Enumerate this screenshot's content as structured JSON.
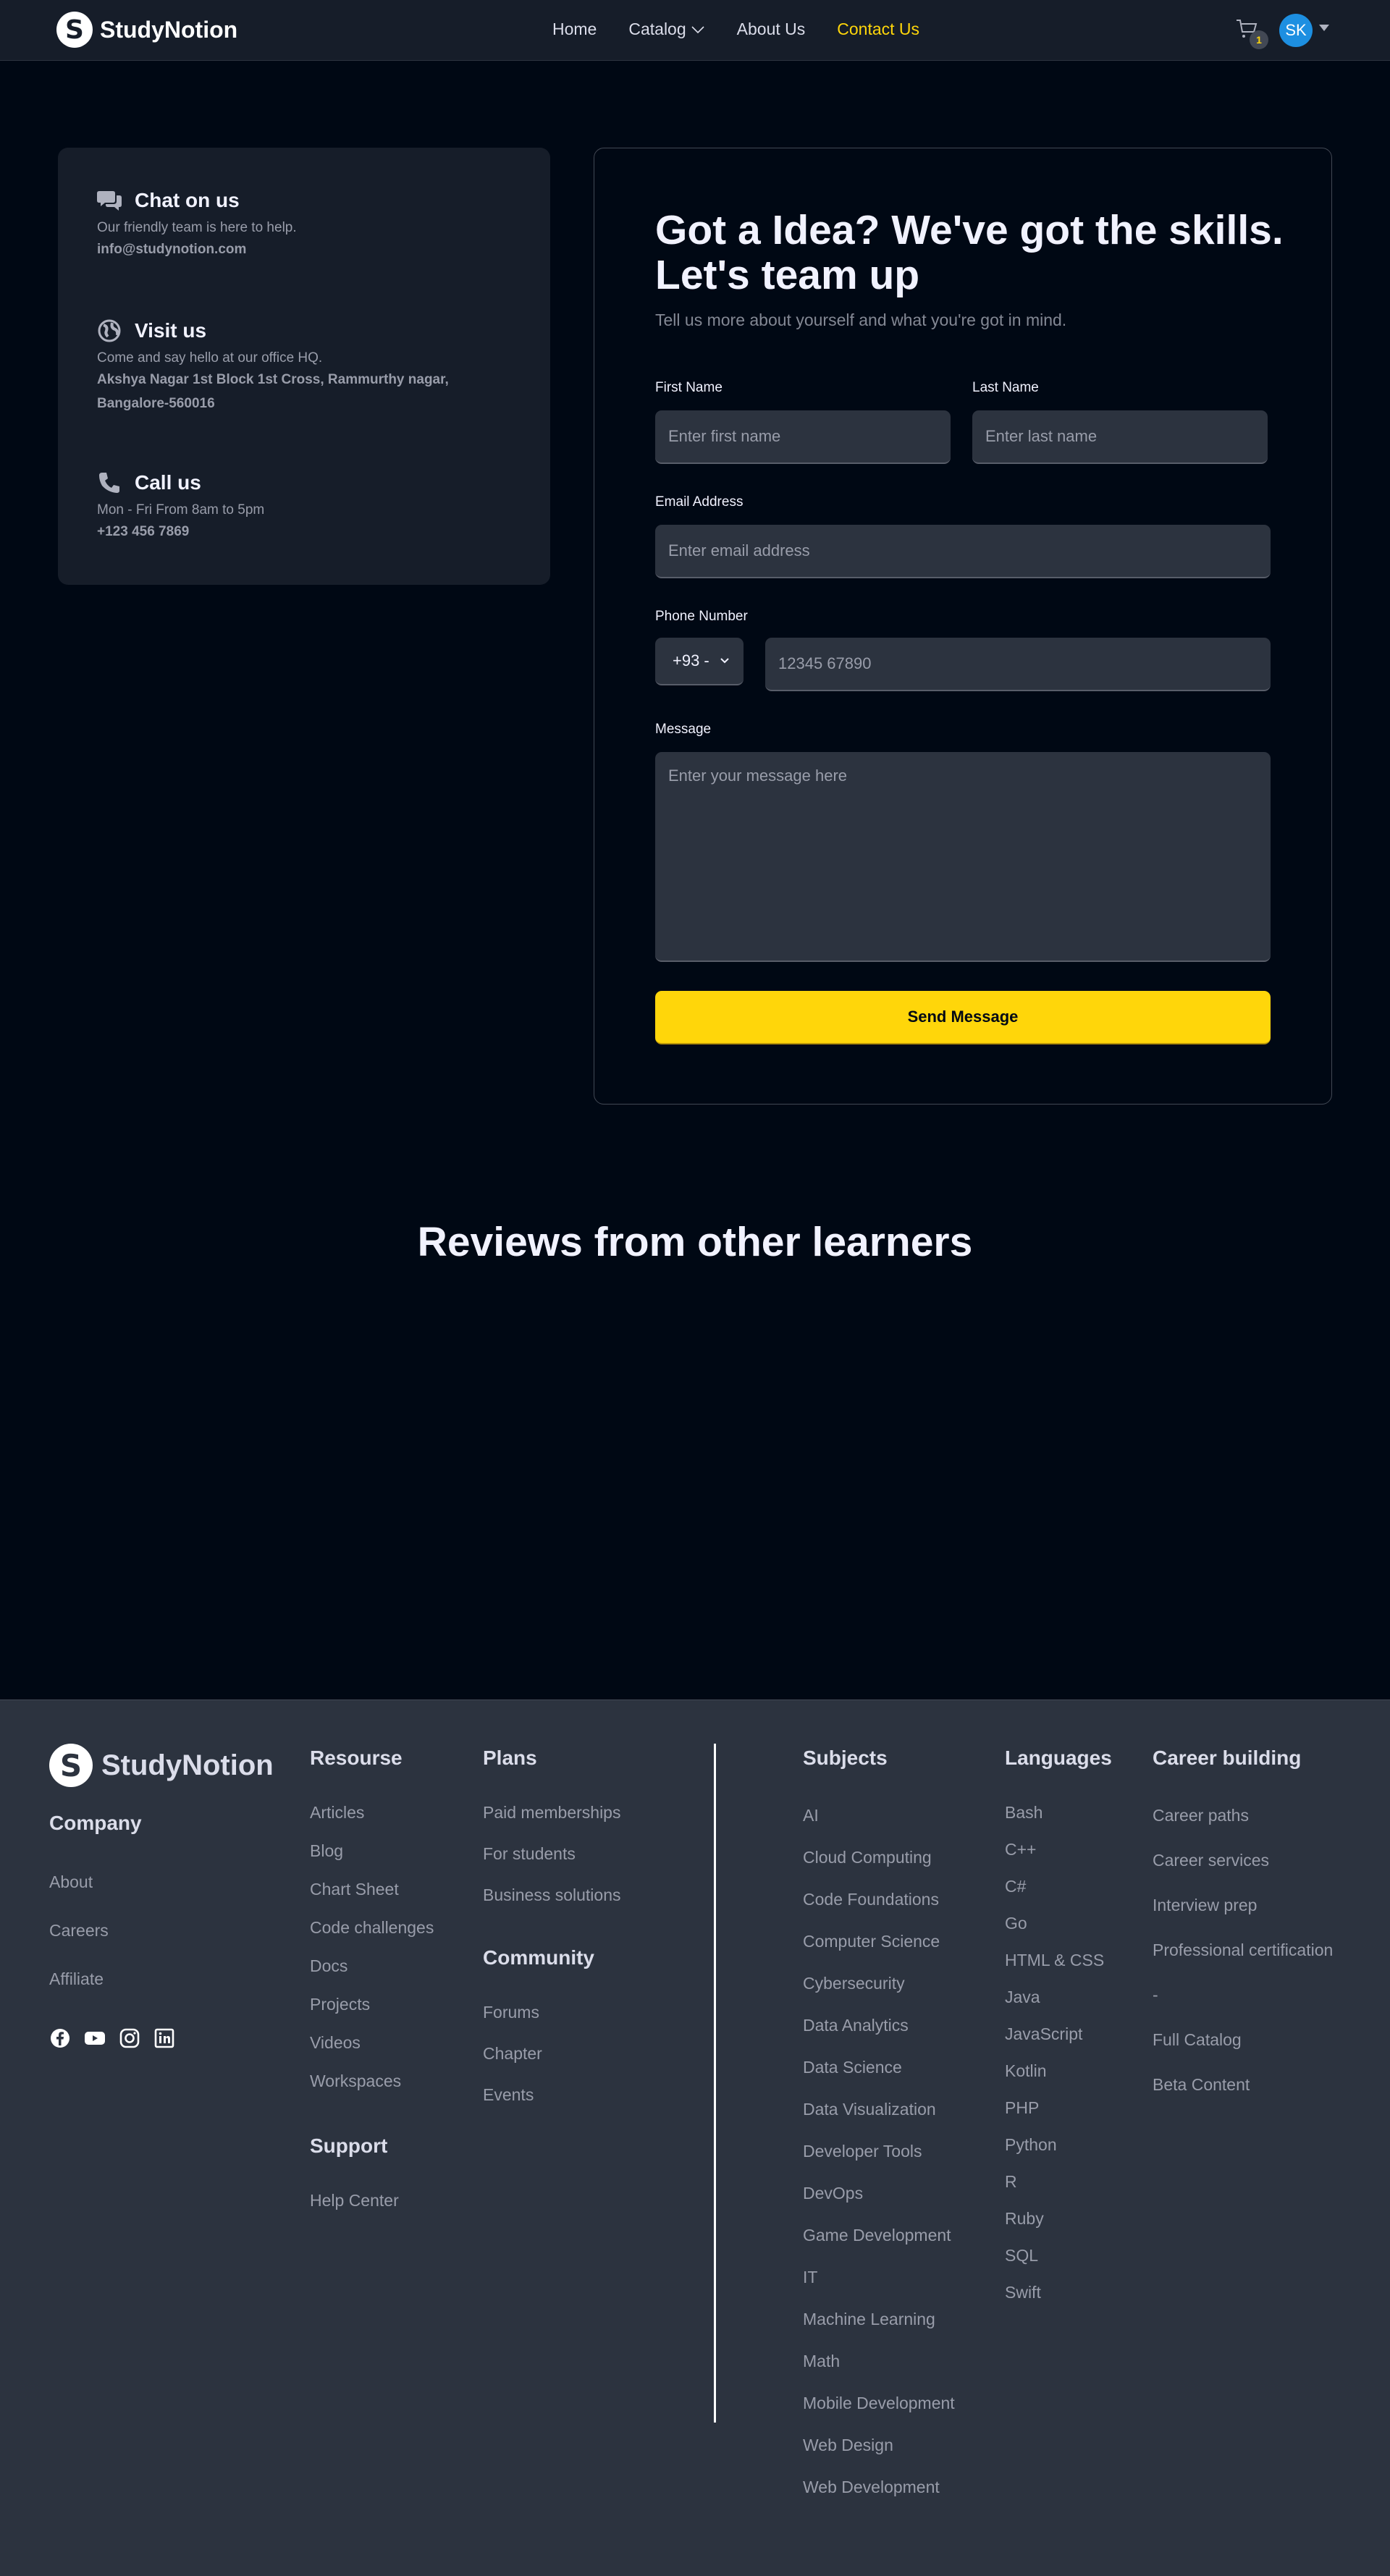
{
  "navbar": {
    "brand": "StudyNotion",
    "logo_letter": "S",
    "links": [
      {
        "label": "Home"
      },
      {
        "label": "Catalog"
      },
      {
        "label": "About Us"
      },
      {
        "label": "Contact Us",
        "active": true
      }
    ],
    "cart_count": "1",
    "avatar_initials": "SK"
  },
  "contact_details": [
    {
      "icon": "chat-icon",
      "title": "Chat on us",
      "text": "Our friendly team is here to help.",
      "strong": "info@studynotion.com"
    },
    {
      "icon": "globe-icon",
      "title": "Visit us",
      "text": "Come and say hello at our office HQ.",
      "strong": "Akshya Nagar 1st Block 1st Cross, Rammurthy nagar, Bangalore-560016"
    },
    {
      "icon": "phone-icon",
      "title": "Call us",
      "text": "Mon - Fri From 8am to 5pm",
      "strong": "+123 456 7869"
    }
  ],
  "form": {
    "title": "Got a Idea? We've got the skills. Let's team up",
    "subtitle": "Tell us more about yourself and what you're got in mind.",
    "first_name": {
      "label": "First Name",
      "placeholder": "Enter first name"
    },
    "last_name": {
      "label": "Last Name",
      "placeholder": "Enter last name"
    },
    "email": {
      "label": "Email Address",
      "placeholder": "Enter email address"
    },
    "phone": {
      "label": "Phone Number",
      "code": "+93 -",
      "placeholder": "12345 67890"
    },
    "message": {
      "label": "Message",
      "placeholder": "Enter your message here"
    },
    "submit": "Send Message"
  },
  "reviews": {
    "title": "Reviews from other learners"
  },
  "footer": {
    "brand": "StudyNotion",
    "logo_letter": "S",
    "company": {
      "title": "Company",
      "items": [
        "About",
        "Careers",
        "Affiliate"
      ]
    },
    "social_icons": [
      "facebook-icon",
      "youtube-icon",
      "instagram-icon",
      "linkedin-icon"
    ],
    "resources": {
      "title": "Resourse",
      "items": [
        "Articles",
        "Blog",
        "Chart Sheet",
        "Code challenges",
        "Docs",
        "Projects",
        "Videos",
        "Workspaces"
      ]
    },
    "support": {
      "title": "Support",
      "items": [
        "Help Center"
      ]
    },
    "plans": {
      "title": "Plans",
      "items": [
        "Paid memberships",
        "For students",
        "Business solutions"
      ]
    },
    "community": {
      "title": "Community",
      "items": [
        "Forums",
        "Chapter",
        "Events"
      ]
    },
    "subjects": {
      "title": "Subjects",
      "items": [
        "AI",
        "Cloud Computing",
        "Code Foundations",
        "Computer Science",
        "Cybersecurity",
        "Data Analytics",
        "Data Science",
        "Data Visualization",
        "Developer Tools",
        "DevOps",
        "Game Development",
        "IT",
        "Machine Learning",
        "Math",
        "Mobile Development",
        "Web Design",
        "Web Development"
      ]
    },
    "languages": {
      "title": "Languages",
      "items": [
        "Bash",
        "C++",
        "C#",
        "Go",
        "HTML & CSS",
        "Java",
        "JavaScript",
        "Kotlin",
        "PHP",
        "Python",
        "R",
        "Ruby",
        "SQL",
        "Swift"
      ]
    },
    "career": {
      "title": "Career building",
      "items": [
        "Career paths",
        "Career services",
        "Interview prep",
        "Professional certification",
        "-",
        "Full Catalog",
        "Beta Content"
      ]
    }
  }
}
